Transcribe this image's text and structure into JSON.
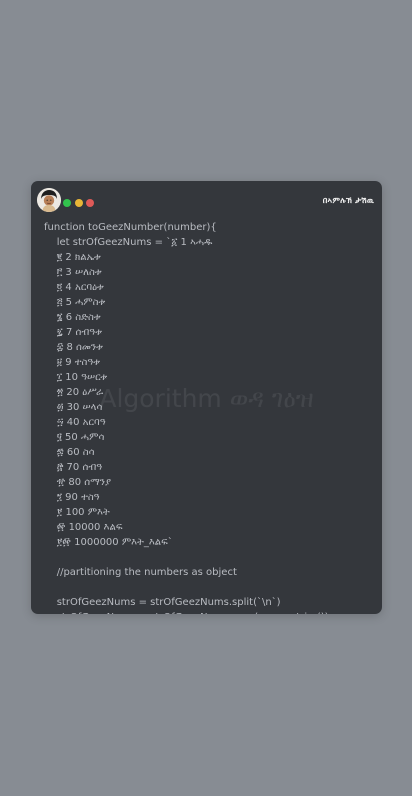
{
  "brand": "በኣምሉኽ ታሽዉ",
  "watermark": "Algorithm ወዳ ገዕዝ",
  "code_lines": [
    "function toGeezNumber(number){",
    "    let strOfGeezNums = `፩ 1 ኣሓዱ",
    "    ፪ 2 ክልኤቱ",
    "    ፫ 3 ሠለስቱ",
    "    ፬ 4 አርባዕቱ",
    "    ፭ 5 ሓምስቱ",
    "    ፮ 6 ስድስቱ",
    "    ፯ 7 ሰብዓቱ",
    "    ፰ 8 ሰመንቱ",
    "    ፱ 9 ተስዓቱ",
    "    ፲ 10 ዓሠርቱ",
    "    ፳ 20 ዕሥራ",
    "    ፴ 30 ሠላሳ",
    "    ፵ 40 አርባዓ",
    "    ፶ 50 ሓምሳ",
    "    ፷ 60 ስሳ",
    "    ፸ 70 ሰብዓ",
    "    ፹ 80 ሰማንያ",
    "    ፺ 90 ተስዓ",
    "    ፻ 100 ምእት",
    "    ፼ 10000 እልፍ",
    "    ፻፼ 1000000 ምእት_እልፍ`",
    "",
    "    //partitioning the numbers as object",
    "",
    "    strOfGeezNums = strOfGeezNums.split(`\\n`)",
    "    strOfGeezNums = strOfGeezNums.map(x => x.trim())"
  ],
  "colors": {
    "page_bg": "#878c93",
    "card_bg": "#34373c",
    "code_text": "#b9bcc2",
    "green_dot": "#32c24d",
    "yellow_dot": "#e8b637",
    "red_dot": "#df5a58"
  },
  "icons": {
    "avatar": "avatar-icon",
    "window_dots": [
      "green-dot-icon",
      "yellow-dot-icon",
      "red-dot-icon"
    ]
  }
}
